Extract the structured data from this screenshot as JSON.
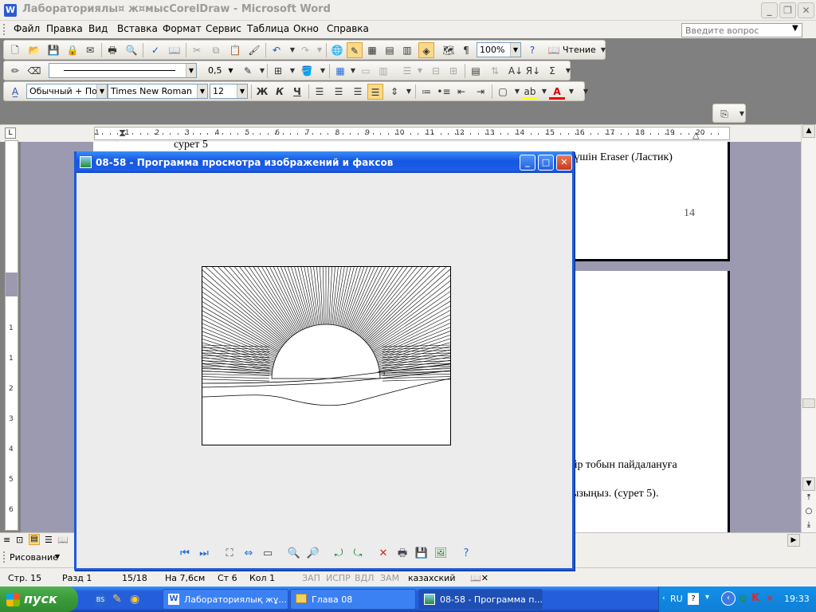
{
  "word": {
    "title": "Лабораториялы¤ ж¤мысCorelDraw - Microsoft Word",
    "menu": [
      "Файл",
      "Правка",
      "Вид",
      "Вставка",
      "Формат",
      "Сервис",
      "Таблица",
      "Окно",
      "Справка"
    ],
    "help_placeholder": "Введите вопрос",
    "zoom": "100%",
    "read_label": "Чтение",
    "line_weight": "0,5",
    "style": "Обычный + По ц",
    "font": "Times New Roman",
    "size": "12",
    "bold": "Ж",
    "italic": "К",
    "underline": "Ч"
  },
  "ruler": {
    "numbers": [
      "1",
      "1",
      "2",
      "3",
      "4",
      "5",
      "6",
      "7",
      "8",
      "9",
      "10",
      "11",
      "12",
      "13",
      "14",
      "15",
      "16",
      "17",
      "18",
      "19",
      "20"
    ]
  },
  "vruler": {
    "numbers": [
      "1",
      "1",
      "2",
      "3",
      "4",
      "5",
      "6",
      "7"
    ]
  },
  "document": {
    "caption_top": "сурет 5",
    "line_eraser": "ı үшін Eraser (Ластик)",
    "page_number": "14",
    "line_group": "йр тобын пайдалануға",
    "line_sozyp": "ызыңыз. (сурет 5)."
  },
  "draw_toolbar": {
    "label": "Рисование"
  },
  "status": {
    "page": "Стр. 15",
    "section": "Разд 1",
    "pages": "15/18",
    "position": "На 7,6см",
    "line": "Ст 6",
    "col": "Кол 1",
    "rec": "ЗАП",
    "trk": "ИСПР",
    "ext": "ВДЛ",
    "ovr": "ЗАМ",
    "lang": "казахский"
  },
  "viewer": {
    "title": "08-58 - Программа просмотра изображений и факсов",
    "icon_names": [
      "prev-image-icon",
      "next-image-icon",
      "best-fit-icon",
      "actual-size-icon",
      "slideshow-icon",
      "zoom-in-icon",
      "zoom-out-icon",
      "rotate-cw-icon",
      "rotate-ccw-icon",
      "delete-icon",
      "print-icon",
      "save-icon",
      "edit-icon",
      "help-icon"
    ]
  },
  "taskbar": {
    "start": "пуск",
    "tasks": [
      "Лабораториялық жұ...",
      "Глава 08",
      "08-58 - Программа п..."
    ],
    "lang": "RU",
    "clock": "19:33"
  },
  "colors": {
    "titlebar": "#1557e3",
    "taskbar": "#245edb",
    "start": "#3c9e3c"
  }
}
